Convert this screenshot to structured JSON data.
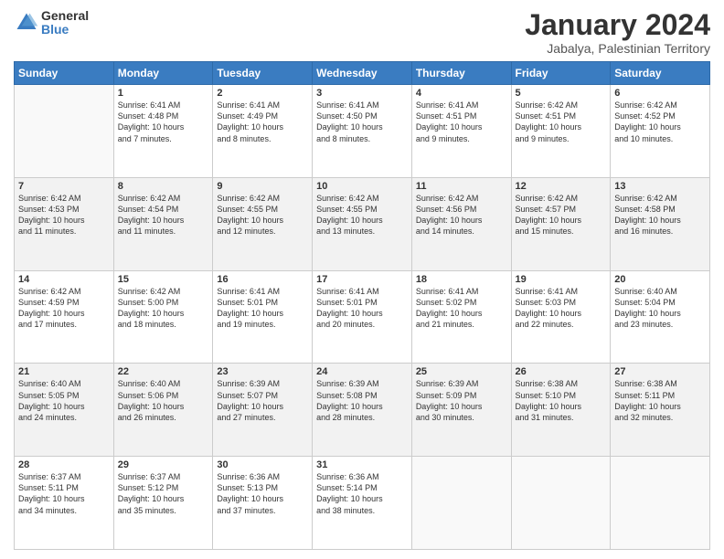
{
  "header": {
    "logo_line1": "General",
    "logo_line2": "Blue",
    "main_title": "January 2024",
    "subtitle": "Jabalya, Palestinian Territory"
  },
  "days_of_week": [
    "Sunday",
    "Monday",
    "Tuesday",
    "Wednesday",
    "Thursday",
    "Friday",
    "Saturday"
  ],
  "weeks": [
    [
      {
        "day": "",
        "info": ""
      },
      {
        "day": "1",
        "info": "Sunrise: 6:41 AM\nSunset: 4:48 PM\nDaylight: 10 hours\nand 7 minutes."
      },
      {
        "day": "2",
        "info": "Sunrise: 6:41 AM\nSunset: 4:49 PM\nDaylight: 10 hours\nand 8 minutes."
      },
      {
        "day": "3",
        "info": "Sunrise: 6:41 AM\nSunset: 4:50 PM\nDaylight: 10 hours\nand 8 minutes."
      },
      {
        "day": "4",
        "info": "Sunrise: 6:41 AM\nSunset: 4:51 PM\nDaylight: 10 hours\nand 9 minutes."
      },
      {
        "day": "5",
        "info": "Sunrise: 6:42 AM\nSunset: 4:51 PM\nDaylight: 10 hours\nand 9 minutes."
      },
      {
        "day": "6",
        "info": "Sunrise: 6:42 AM\nSunset: 4:52 PM\nDaylight: 10 hours\nand 10 minutes."
      }
    ],
    [
      {
        "day": "7",
        "info": "Sunrise: 6:42 AM\nSunset: 4:53 PM\nDaylight: 10 hours\nand 11 minutes."
      },
      {
        "day": "8",
        "info": "Sunrise: 6:42 AM\nSunset: 4:54 PM\nDaylight: 10 hours\nand 11 minutes."
      },
      {
        "day": "9",
        "info": "Sunrise: 6:42 AM\nSunset: 4:55 PM\nDaylight: 10 hours\nand 12 minutes."
      },
      {
        "day": "10",
        "info": "Sunrise: 6:42 AM\nSunset: 4:55 PM\nDaylight: 10 hours\nand 13 minutes."
      },
      {
        "day": "11",
        "info": "Sunrise: 6:42 AM\nSunset: 4:56 PM\nDaylight: 10 hours\nand 14 minutes."
      },
      {
        "day": "12",
        "info": "Sunrise: 6:42 AM\nSunset: 4:57 PM\nDaylight: 10 hours\nand 15 minutes."
      },
      {
        "day": "13",
        "info": "Sunrise: 6:42 AM\nSunset: 4:58 PM\nDaylight: 10 hours\nand 16 minutes."
      }
    ],
    [
      {
        "day": "14",
        "info": "Sunrise: 6:42 AM\nSunset: 4:59 PM\nDaylight: 10 hours\nand 17 minutes."
      },
      {
        "day": "15",
        "info": "Sunrise: 6:42 AM\nSunset: 5:00 PM\nDaylight: 10 hours\nand 18 minutes."
      },
      {
        "day": "16",
        "info": "Sunrise: 6:41 AM\nSunset: 5:01 PM\nDaylight: 10 hours\nand 19 minutes."
      },
      {
        "day": "17",
        "info": "Sunrise: 6:41 AM\nSunset: 5:01 PM\nDaylight: 10 hours\nand 20 minutes."
      },
      {
        "day": "18",
        "info": "Sunrise: 6:41 AM\nSunset: 5:02 PM\nDaylight: 10 hours\nand 21 minutes."
      },
      {
        "day": "19",
        "info": "Sunrise: 6:41 AM\nSunset: 5:03 PM\nDaylight: 10 hours\nand 22 minutes."
      },
      {
        "day": "20",
        "info": "Sunrise: 6:40 AM\nSunset: 5:04 PM\nDaylight: 10 hours\nand 23 minutes."
      }
    ],
    [
      {
        "day": "21",
        "info": "Sunrise: 6:40 AM\nSunset: 5:05 PM\nDaylight: 10 hours\nand 24 minutes."
      },
      {
        "day": "22",
        "info": "Sunrise: 6:40 AM\nSunset: 5:06 PM\nDaylight: 10 hours\nand 26 minutes."
      },
      {
        "day": "23",
        "info": "Sunrise: 6:39 AM\nSunset: 5:07 PM\nDaylight: 10 hours\nand 27 minutes."
      },
      {
        "day": "24",
        "info": "Sunrise: 6:39 AM\nSunset: 5:08 PM\nDaylight: 10 hours\nand 28 minutes."
      },
      {
        "day": "25",
        "info": "Sunrise: 6:39 AM\nSunset: 5:09 PM\nDaylight: 10 hours\nand 30 minutes."
      },
      {
        "day": "26",
        "info": "Sunrise: 6:38 AM\nSunset: 5:10 PM\nDaylight: 10 hours\nand 31 minutes."
      },
      {
        "day": "27",
        "info": "Sunrise: 6:38 AM\nSunset: 5:11 PM\nDaylight: 10 hours\nand 32 minutes."
      }
    ],
    [
      {
        "day": "28",
        "info": "Sunrise: 6:37 AM\nSunset: 5:11 PM\nDaylight: 10 hours\nand 34 minutes."
      },
      {
        "day": "29",
        "info": "Sunrise: 6:37 AM\nSunset: 5:12 PM\nDaylight: 10 hours\nand 35 minutes."
      },
      {
        "day": "30",
        "info": "Sunrise: 6:36 AM\nSunset: 5:13 PM\nDaylight: 10 hours\nand 37 minutes."
      },
      {
        "day": "31",
        "info": "Sunrise: 6:36 AM\nSunset: 5:14 PM\nDaylight: 10 hours\nand 38 minutes."
      },
      {
        "day": "",
        "info": ""
      },
      {
        "day": "",
        "info": ""
      },
      {
        "day": "",
        "info": ""
      }
    ]
  ]
}
